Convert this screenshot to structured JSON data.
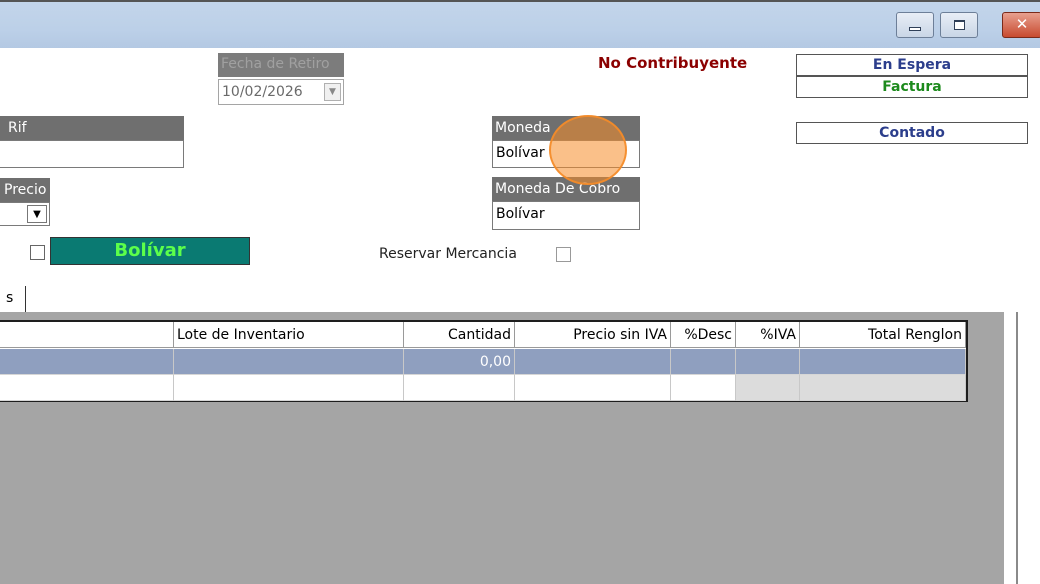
{
  "window": {
    "minimize_glyph": "",
    "maximize_glyph": "",
    "close_glyph": "✕"
  },
  "fecha_retiro": {
    "label": "Fecha de Retiro",
    "value": "10/02/2026"
  },
  "no_contribuyente": "No Contribuyente",
  "status": {
    "en_espera": "En Espera",
    "factura": "Factura",
    "contado": "Contado"
  },
  "rif": {
    "label": "Rif",
    "value": ""
  },
  "moneda": {
    "label": "Moneda",
    "value": "Bolívar"
  },
  "lista_precio": {
    "label": "Precio",
    "value": ""
  },
  "moneda_cobro": {
    "label": "Moneda De Cobro",
    "value": "Bolívar"
  },
  "moneda_badge": "Bolívar",
  "reservar_mercancia": "Reservar Mercancia",
  "tab": "s",
  "grid": {
    "columns": [
      "",
      "Lote de Inventario",
      "Cantidad",
      "Precio sin IVA",
      "%Desc",
      "%IVA",
      "Total Renglon"
    ],
    "rows": [
      [
        "",
        "",
        "0,00",
        "",
        "",
        "",
        ""
      ],
      [
        "",
        "",
        "",
        "",
        "",
        "",
        ""
      ]
    ]
  },
  "colors": {
    "accent_badge": "#0a7a72",
    "badge_text": "#5cff4a",
    "no_contribuyente": "#8b0000",
    "en_espera": "#2c3e8c",
    "factura": "#1c8a1c",
    "contado": "#2c3e8c",
    "selected_row": "#8f9fbf"
  }
}
